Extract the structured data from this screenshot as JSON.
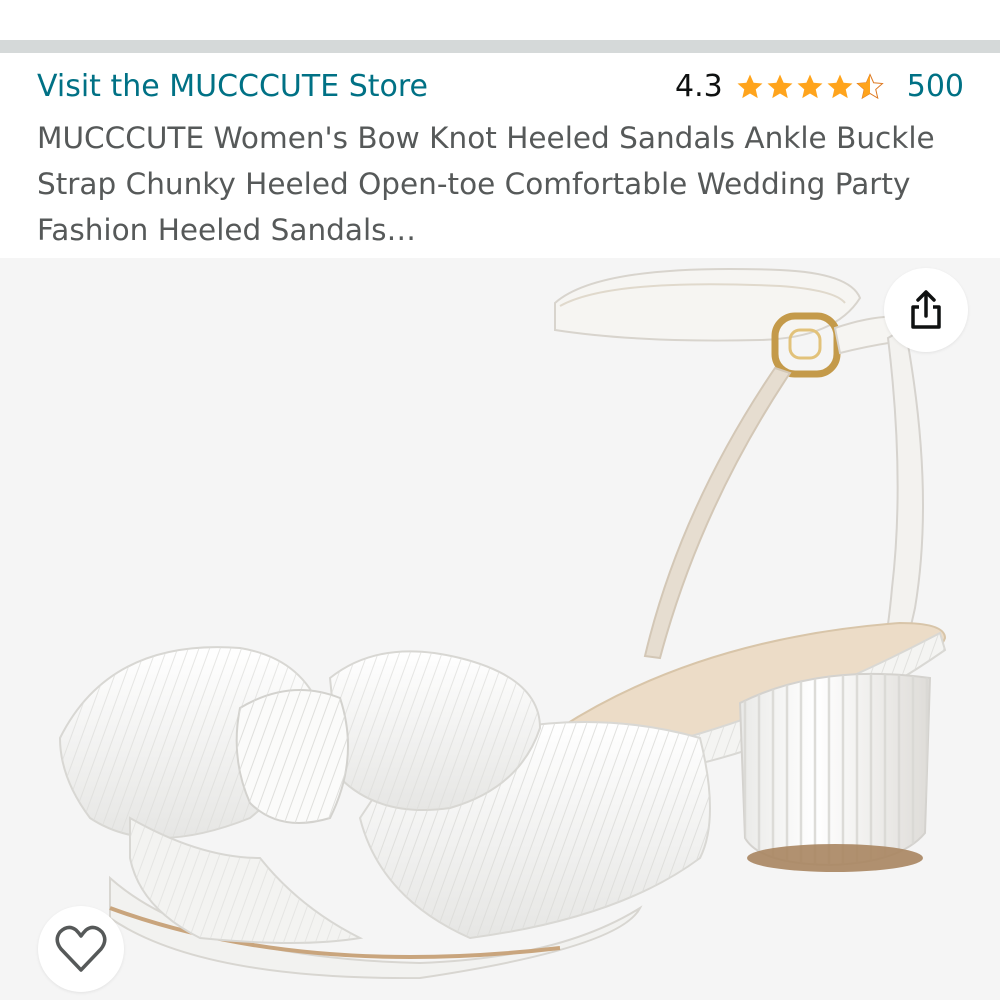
{
  "product": {
    "store_link": "Visit the MUCCCUTE Store",
    "rating_value": "4.3",
    "rating_stars": 4.3,
    "rating_count": "500",
    "title": "MUCCCUTE Women's Bow Knot Heeled Sandals Ankle Buckle Strap Chunky Heeled Open-toe Comfortable Wedding Party Fashion Heeled Sandals…"
  },
  "gallery": {
    "image_subject": "white pleated bow-knot block-heel sandal with ankle strap and gold buckle",
    "share_icon": "share-icon",
    "wishlist_icon": "heart-outline-icon"
  },
  "colors": {
    "link": "#007185",
    "star": "#ffa41c",
    "title_text": "#565959",
    "divider": "#d5d9d9",
    "gallery_bg": "#f5f5f5"
  }
}
